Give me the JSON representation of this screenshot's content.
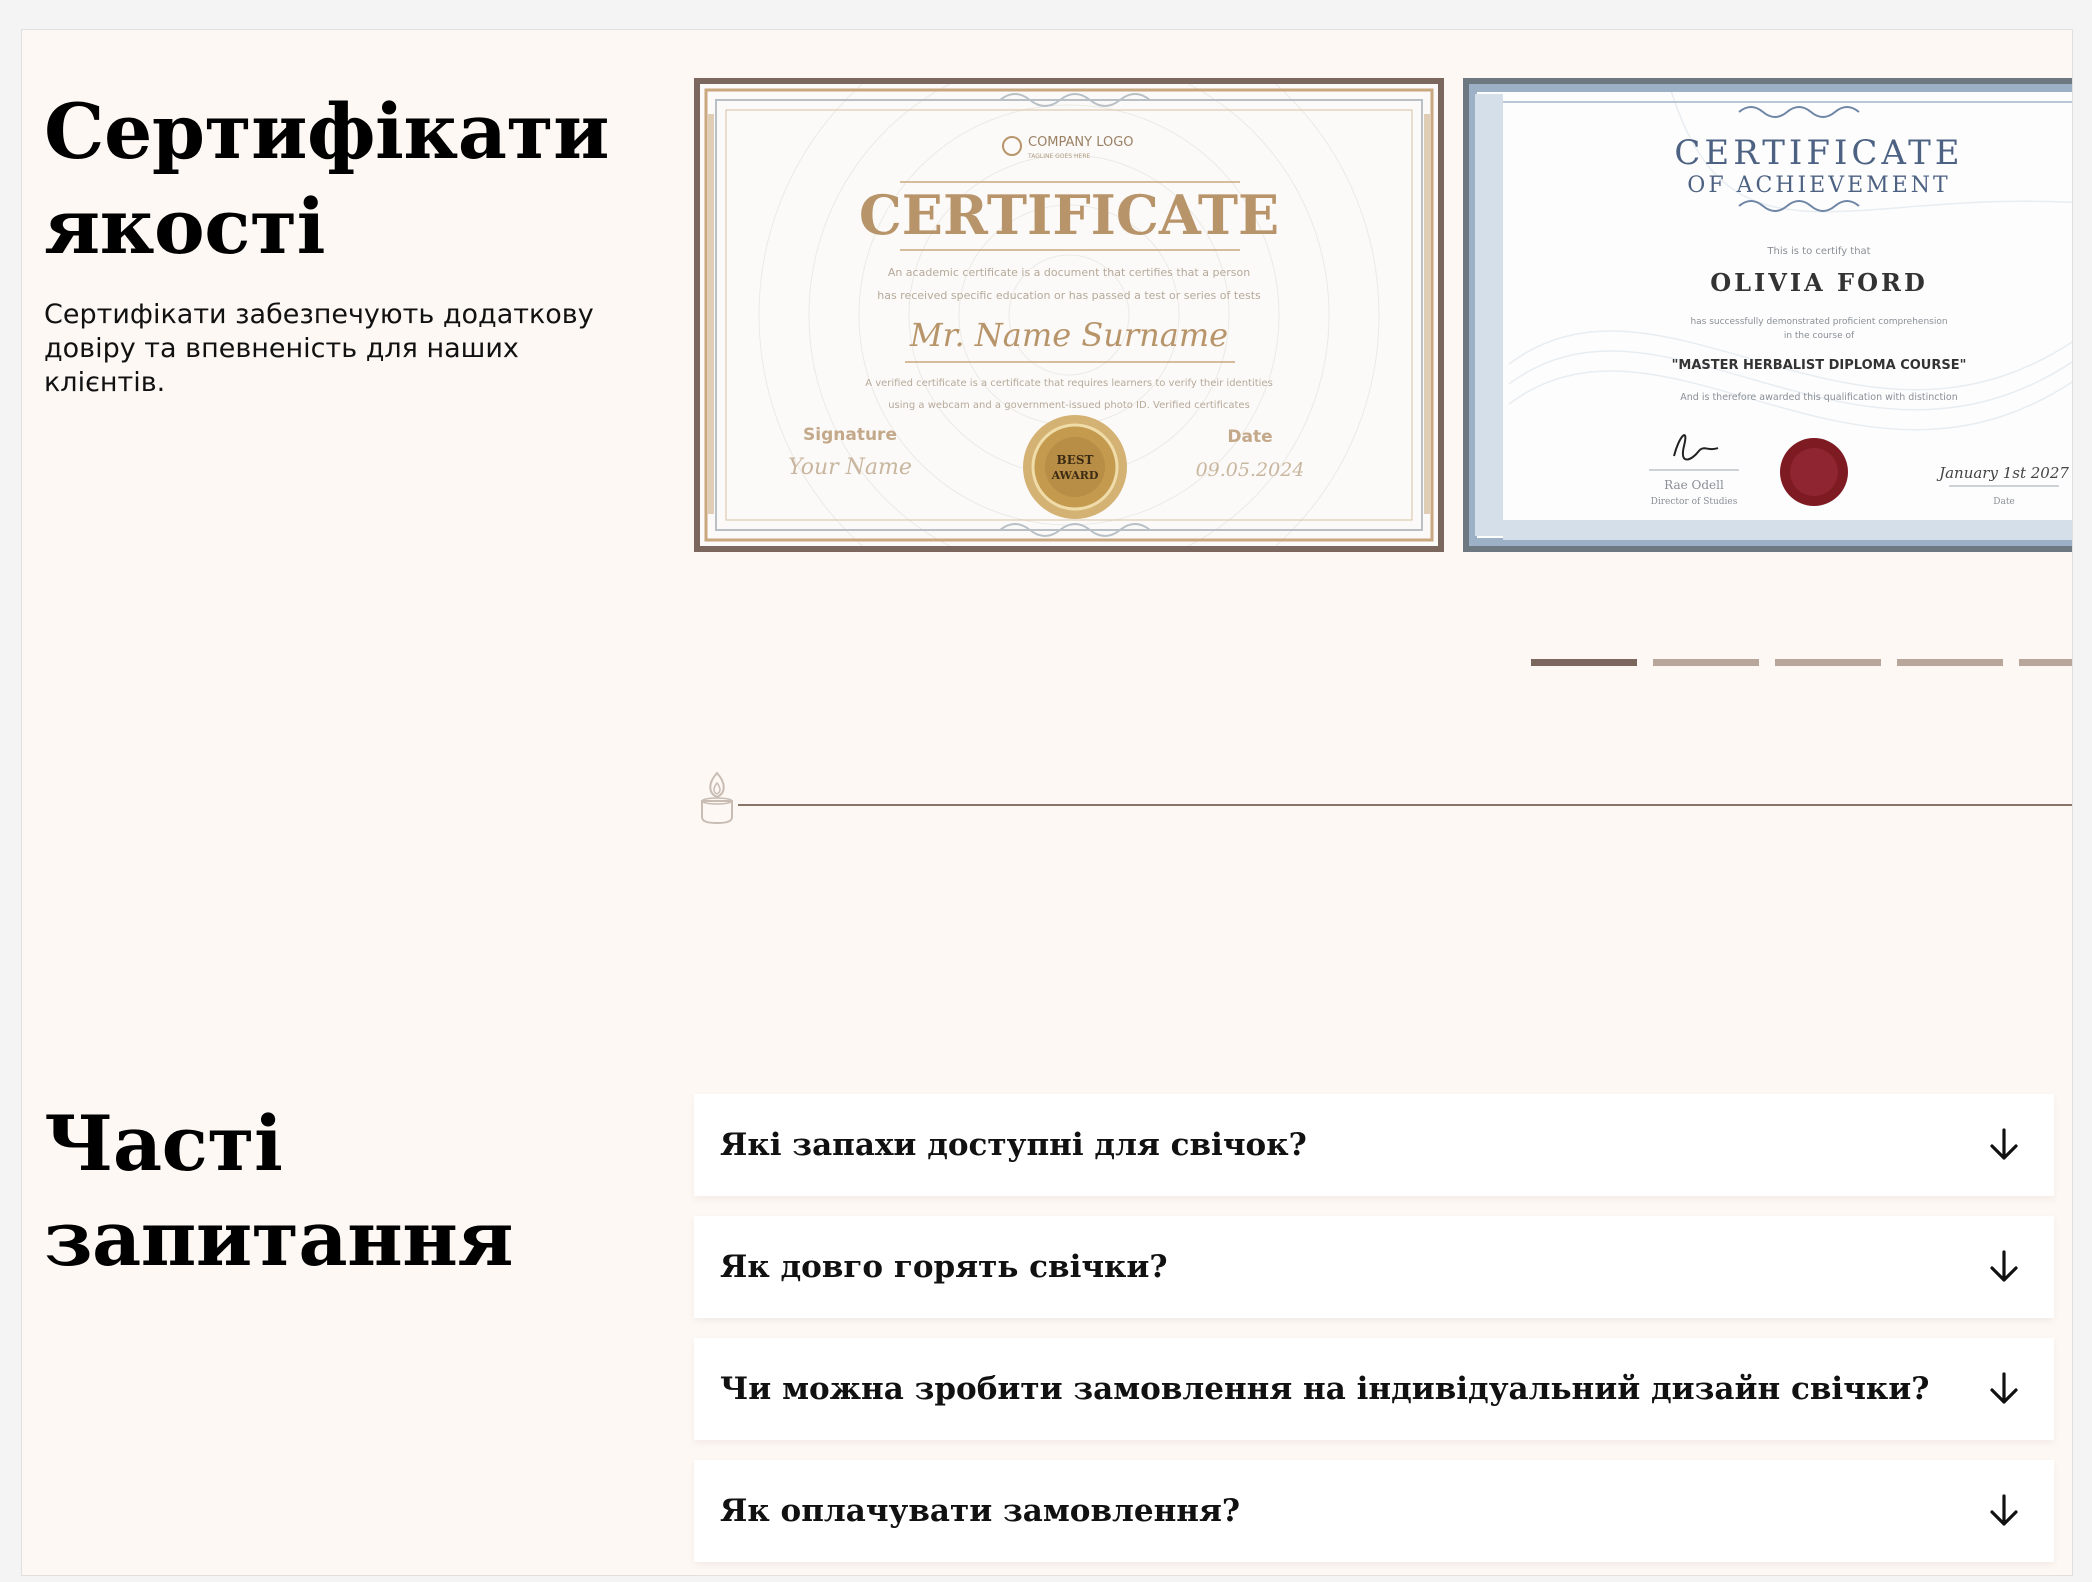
{
  "certificates": {
    "title_line1": "Сертифікати",
    "title_line2": "якості",
    "description": "Сертифікати забезпечують додаткову довіру та впевненість для наших клієнтів.",
    "slides": [
      {
        "company_logo": "COMPANY LOGO",
        "logo_tagline": "TAGLINE GOES HERE",
        "heading": "CERTIFICATE",
        "intro_line1": "An academic certificate is a document that certifies that a person",
        "intro_line2": "has received specific education or has passed a test or series of tests",
        "recipient": "Mr. Name Surname",
        "body_line1": "A verified certificate is a certificate that requires learners to verify their identities",
        "body_line2": "using a webcam and a government-issued photo ID. Verified certificates",
        "signature_label": "Signature",
        "signature_value": "Your Name",
        "date_label": "Date",
        "date_value": "09.05.2024",
        "seal_text_1": "BEST",
        "seal_text_2": "AWARD"
      },
      {
        "heading_line1": "CERTIFICATE",
        "heading_line2": "OF ACHIEVEMENT",
        "intro": "This is to certify that",
        "recipient": "OLIVIA FORD",
        "body_line1": "has successfully demonstrated proficient comprehension",
        "body_line2": "in the course of",
        "course": "\"MASTER HERBALIST DIPLOMA COURSE\"",
        "award_line": "And is therefore awarded this qualification with distinction",
        "signer_name": "Rae Odell",
        "signer_title": "Director of Studies",
        "date_value": "January 1st 2027",
        "date_label": "Date"
      }
    ],
    "pagination": {
      "count": 5,
      "active_index": 0
    }
  },
  "faq": {
    "title_line1": "Часті",
    "title_line2": "запитання",
    "items": [
      {
        "question": "Які запахи доступні для свічок?"
      },
      {
        "question": "Як довго горять свічки?"
      },
      {
        "question": "Чи можна зробити замовлення на індивідуальний дизайн свічки?"
      },
      {
        "question": "Як оплачувати замовлення?"
      }
    ]
  },
  "colors": {
    "page_background": "#fdf8f4",
    "accent_brown": "#7c675e",
    "dot_inactive": "#b8a69b",
    "gold": "#b8946a",
    "blue_frame": "#9cb0c6"
  },
  "icons": {
    "divider_icon": "candle-icon",
    "faq_toggle": "arrow-down-icon"
  }
}
